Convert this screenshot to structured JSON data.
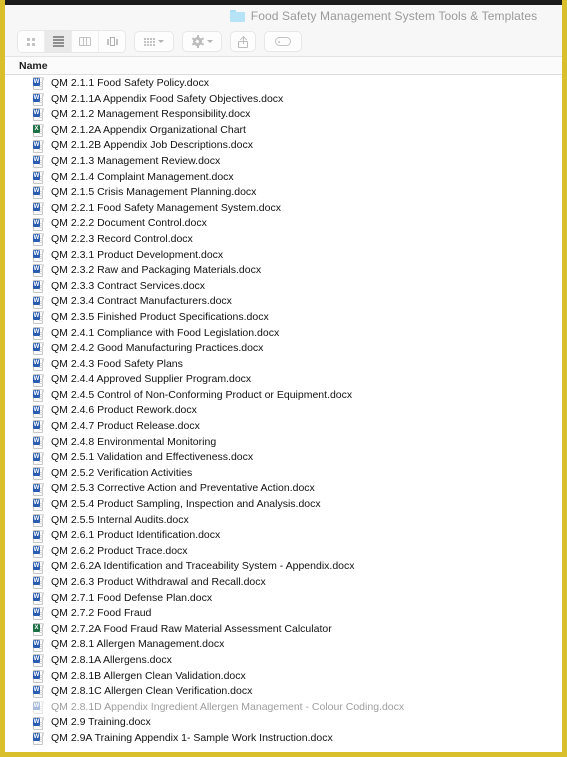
{
  "window": {
    "title": "Food Safety Management System Tools & Templates",
    "folder_icon": "folder-icon",
    "accent_highlight_color": "#d9bf2b"
  },
  "toolbar": {
    "view_modes": [
      {
        "name": "icon-view",
        "icon": "grid-icon",
        "active": false
      },
      {
        "name": "list-view",
        "icon": "list-icon",
        "active": true
      },
      {
        "name": "column-view",
        "icon": "columns-icon",
        "active": false
      },
      {
        "name": "gallery-view",
        "icon": "gallery-icon",
        "active": false
      }
    ],
    "group_by": {
      "name": "group-by-button",
      "icon": "group-grid-icon",
      "has_menu": true
    },
    "action": {
      "name": "action-menu-button",
      "icon": "gear-icon",
      "has_menu": true
    },
    "share": {
      "name": "share-button",
      "icon": "share-icon"
    },
    "tags": {
      "name": "tags-button",
      "icon": "tag-icon"
    }
  },
  "columns": [
    {
      "key": "name",
      "label": "Name"
    }
  ],
  "files": [
    {
      "name": "QM 2.1.1 Food Safety Policy.docx",
      "type": "word",
      "badge": "W",
      "faded": false
    },
    {
      "name": "QM 2.1.1A Appendix Food Safety Objectives.docx",
      "type": "word",
      "badge": "W",
      "faded": false
    },
    {
      "name": "QM 2.1.2 Management Responsibility.docx",
      "type": "word",
      "badge": "W",
      "faded": false
    },
    {
      "name": "QM 2.1.2A Appendix Organizational Chart",
      "type": "excel",
      "badge": "X",
      "faded": false
    },
    {
      "name": "QM 2.1.2B Appendix Job Descriptions.docx",
      "type": "word",
      "badge": "W",
      "faded": false
    },
    {
      "name": "QM 2.1.3 Management Review.docx",
      "type": "word",
      "badge": "W",
      "faded": false
    },
    {
      "name": "QM 2.1.4 Complaint Management.docx",
      "type": "word",
      "badge": "W",
      "faded": false
    },
    {
      "name": "QM 2.1.5 Crisis Management Planning.docx",
      "type": "word",
      "badge": "W",
      "faded": false
    },
    {
      "name": "QM 2.2.1 Food Safety Management System.docx",
      "type": "word",
      "badge": "W",
      "faded": false
    },
    {
      "name": "QM 2.2.2 Document Control.docx",
      "type": "word",
      "badge": "W",
      "faded": false
    },
    {
      "name": "QM 2.2.3 Record Control.docx",
      "type": "word",
      "badge": "W",
      "faded": false
    },
    {
      "name": "QM 2.3.1 Product Development.docx",
      "type": "word",
      "badge": "W",
      "faded": false
    },
    {
      "name": "QM 2.3.2 Raw and Packaging Materials.docx",
      "type": "word",
      "badge": "W",
      "faded": false
    },
    {
      "name": "QM 2.3.3 Contract Services.docx",
      "type": "word",
      "badge": "W",
      "faded": false
    },
    {
      "name": "QM 2.3.4 Contract Manufacturers.docx",
      "type": "word",
      "badge": "W",
      "faded": false
    },
    {
      "name": "QM 2.3.5 Finished Product Specifications.docx",
      "type": "word",
      "badge": "W",
      "faded": false
    },
    {
      "name": "QM 2.4.1 Compliance with Food Legislation.docx",
      "type": "word",
      "badge": "W",
      "faded": false
    },
    {
      "name": "QM 2.4.2 Good Manufacturing Practices.docx",
      "type": "word",
      "badge": "W",
      "faded": false
    },
    {
      "name": "QM 2.4.3 Food Safety Plans",
      "type": "word",
      "badge": "W",
      "faded": false
    },
    {
      "name": "QM 2.4.4 Approved Supplier Program.docx",
      "type": "word",
      "badge": "W",
      "faded": false
    },
    {
      "name": "QM 2.4.5 Control of Non-Conforming Product or Equipment.docx",
      "type": "word",
      "badge": "W",
      "faded": false
    },
    {
      "name": "QM 2.4.6 Product Rework.docx",
      "type": "word",
      "badge": "W",
      "faded": false
    },
    {
      "name": "QM 2.4.7 Product Release.docx",
      "type": "word",
      "badge": "W",
      "faded": false
    },
    {
      "name": "QM 2.4.8 Environmental Monitoring",
      "type": "word",
      "badge": "W",
      "faded": false
    },
    {
      "name": "QM 2.5.1 Validation and Effectiveness.docx",
      "type": "word",
      "badge": "W",
      "faded": false
    },
    {
      "name": "QM 2.5.2 Verification Activities",
      "type": "word",
      "badge": "W",
      "faded": false
    },
    {
      "name": "QM 2.5.3 Corrective Action and Preventative Action.docx",
      "type": "word",
      "badge": "W",
      "faded": false
    },
    {
      "name": "QM 2.5.4 Product Sampling, Inspection and Analysis.docx",
      "type": "word",
      "badge": "W",
      "faded": false
    },
    {
      "name": "QM 2.5.5 Internal Audits.docx",
      "type": "word",
      "badge": "W",
      "faded": false
    },
    {
      "name": "QM 2.6.1 Product Identification.docx",
      "type": "word",
      "badge": "W",
      "faded": false
    },
    {
      "name": "QM 2.6.2 Product Trace.docx",
      "type": "word",
      "badge": "W",
      "faded": false
    },
    {
      "name": "QM 2.6.2A Identification and Traceability System - Appendix.docx",
      "type": "word",
      "badge": "W",
      "faded": false
    },
    {
      "name": "QM 2.6.3 Product Withdrawal and Recall.docx",
      "type": "word",
      "badge": "W",
      "faded": false
    },
    {
      "name": "QM 2.7.1 Food Defense Plan.docx",
      "type": "word",
      "badge": "W",
      "faded": false
    },
    {
      "name": "QM 2.7.2 Food Fraud",
      "type": "word",
      "badge": "W",
      "faded": false
    },
    {
      "name": "QM 2.7.2A Food Fraud Raw Material Assessment Calculator",
      "type": "excel",
      "badge": "X",
      "faded": false
    },
    {
      "name": "QM 2.8.1 Allergen Management.docx",
      "type": "word",
      "badge": "W",
      "faded": false
    },
    {
      "name": "QM 2.8.1A Allergens.docx",
      "type": "word",
      "badge": "W",
      "faded": false
    },
    {
      "name": "QM 2.8.1B Allergen Clean Validation.docx",
      "type": "word",
      "badge": "W",
      "faded": false
    },
    {
      "name": "QM 2.8.1C Allergen Clean Verification.docx",
      "type": "word",
      "badge": "W",
      "faded": false
    },
    {
      "name": "QM 2.8.1D Appendix Ingredient Allergen Management - Colour Coding.docx",
      "type": "word",
      "badge": "W",
      "faded": true
    },
    {
      "name": "QM 2.9 Training.docx",
      "type": "word",
      "badge": "W",
      "faded": false
    },
    {
      "name": "QM 2.9A Training Appendix 1- Sample Work Instruction.docx",
      "type": "word",
      "badge": "W",
      "faded": false
    }
  ]
}
